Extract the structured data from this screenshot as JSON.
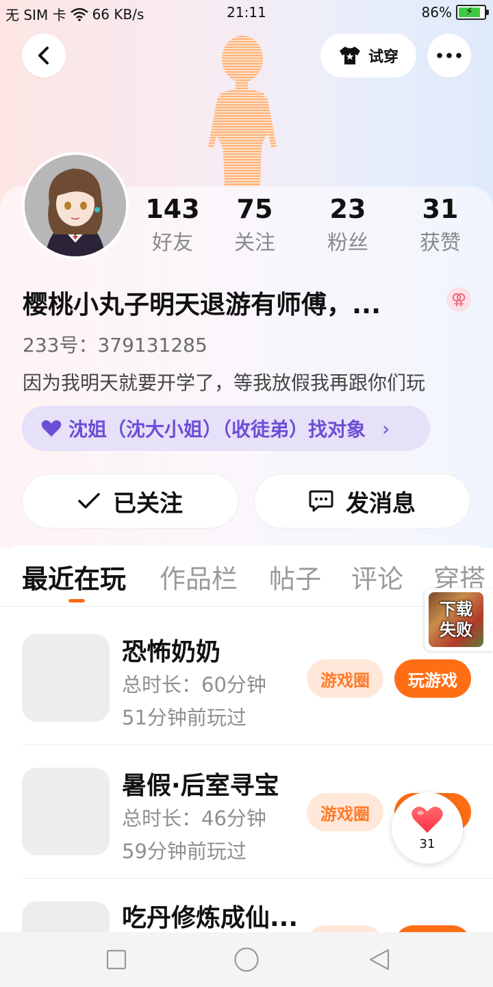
{
  "status_bar": {
    "carrier": "无 SIM 卡",
    "net_speed": "66 KB/s",
    "time": "21:11",
    "battery": "86%",
    "battery_level": 0.86
  },
  "header": {
    "back_icon": "chevron-left-icon",
    "tryon_label": "试穿",
    "more_icon": "more-dots-icon"
  },
  "stats": [
    {
      "value": "143",
      "label": "好友"
    },
    {
      "value": "75",
      "label": "关注"
    },
    {
      "value": "23",
      "label": "粉丝"
    },
    {
      "value": "31",
      "label": "获赞"
    }
  ],
  "profile": {
    "name": "樱桃小丸子明天退游有师傅，...",
    "gender_icon": "female-icon",
    "uid": "233号：379131285",
    "bio": "因为我明天就要开学了，等我放假我再跟你们玩",
    "relation": "沈姐（沈大小姐）（收徒弟）找对象"
  },
  "actions": {
    "followed_label": "已关注",
    "message_label": "发消息"
  },
  "tabs": [
    "最近在玩",
    "作品栏",
    "帖子",
    "评论",
    "穿搭"
  ],
  "active_tab": 0,
  "download_badge": {
    "line1": "下载",
    "line2": "失败"
  },
  "games": [
    {
      "title": "恐怖奶奶",
      "duration": "总时长：60分钟",
      "last_played": "51分钟前玩过",
      "circle_label": "游戏圈",
      "play_label": "玩游戏"
    },
    {
      "title": "暑假·后室寻宝",
      "duration": "总时长：46分钟",
      "last_played": "59分钟前玩过",
      "circle_label": "游戏圈",
      "play_label": ""
    },
    {
      "title": "吃丹修炼成仙...",
      "duration": "",
      "last_played": "",
      "circle_label": "",
      "play_label": ""
    }
  ],
  "like_float": {
    "count": "31"
  },
  "colors": {
    "accent": "#ff6e14",
    "relation_text": "#6a4fd6",
    "relation_bg": "#e6e0f9"
  }
}
